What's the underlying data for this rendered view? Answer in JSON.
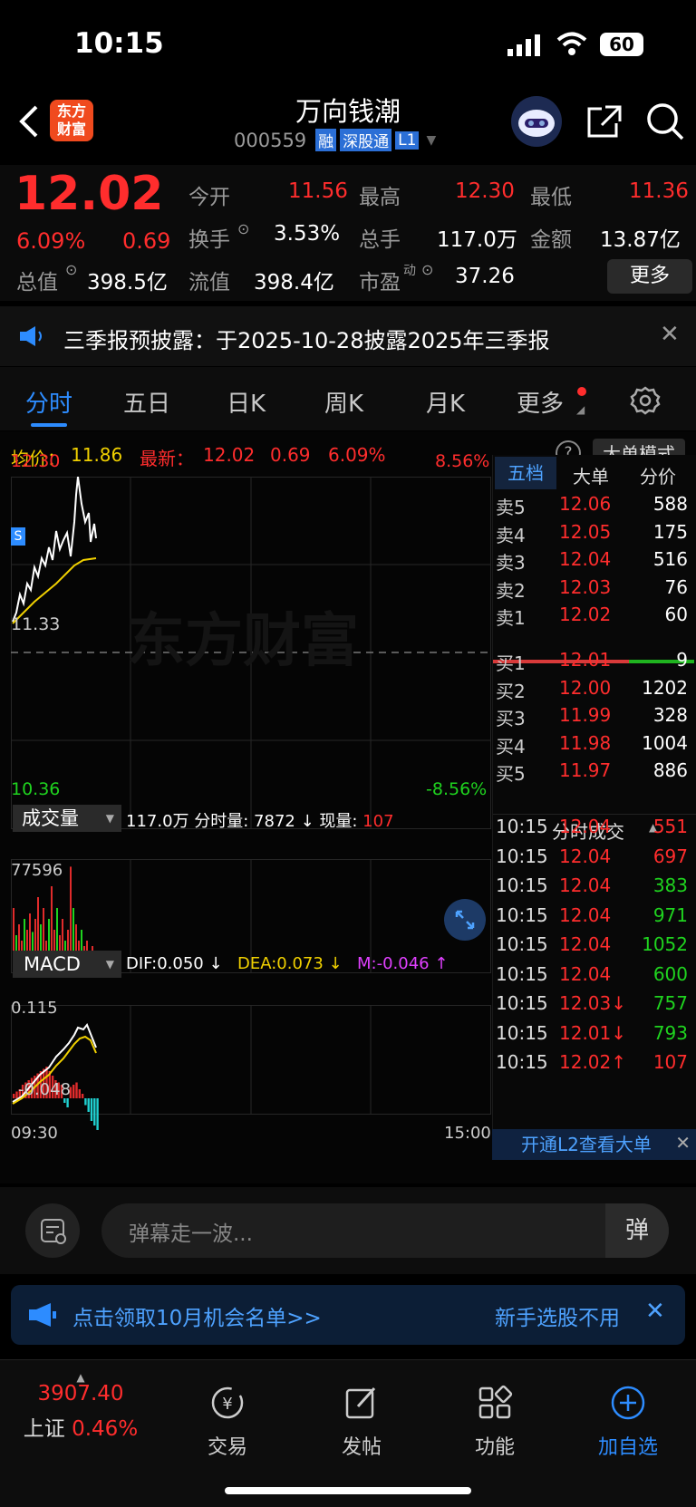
{
  "status": {
    "time": "10:15",
    "battery": "60"
  },
  "nav": {
    "logo_line1": "东方",
    "logo_line2": "财富",
    "title": "万向钱潮",
    "code": "000559",
    "tags": [
      "融",
      "深股通",
      "L1"
    ]
  },
  "quote": {
    "price": "12.02",
    "pct": "6.09%",
    "chg": "0.69",
    "stats": [
      {
        "label": "今开",
        "value": "11.56"
      },
      {
        "label": "最高",
        "value": "12.30"
      },
      {
        "label": "最低",
        "value": "11.36"
      },
      {
        "label": "换手",
        "value": "3.53%"
      },
      {
        "label": "总手",
        "value": "117.0万"
      },
      {
        "label": "金额",
        "value": "13.87亿"
      },
      {
        "label": "总值",
        "value": "398.5亿"
      },
      {
        "label": "流值",
        "value": "398.4亿"
      },
      {
        "label": "市盈",
        "sup": "动",
        "value": "37.26"
      }
    ],
    "more": "更多"
  },
  "notice": {
    "text": "三季报预披露：于2025-10-28披露2025年三季报"
  },
  "tabs": [
    "分时",
    "五日",
    "日K",
    "周K",
    "月K",
    "更多"
  ],
  "chart": {
    "avg_label": "均价：",
    "avg": "11.86",
    "latest_label": "最新：",
    "latest": "12.02",
    "chg": "0.69",
    "pct": "6.09%",
    "mode_btn": "大单模式",
    "y_top": "12.30",
    "y_mid": "11.33",
    "y_bot": "10.36",
    "pct_top": "8.56%",
    "pct_bot": "-8.56%",
    "watermark": "东方财富",
    "vol_label": "成交量",
    "vol_info": "117.0万 分时量: 7872 ↓ 现量: ",
    "vol_now": "107",
    "vol_max": "77596",
    "macd_label": "MACD",
    "dif": "DIF:0.050 ↓",
    "dea": "DEA:0.073 ↓",
    "m": "M:-0.046 ↑",
    "macd_top": "0.115",
    "macd_bot": "-0.048",
    "t_start": "09:30",
    "t_end": "15:00"
  },
  "orderbook": {
    "tabs": [
      "五档",
      "大单",
      "分价"
    ],
    "asks": [
      {
        "l": "卖5",
        "p": "12.06",
        "v": "588"
      },
      {
        "l": "卖4",
        "p": "12.05",
        "v": "175"
      },
      {
        "l": "卖3",
        "p": "12.04",
        "v": "516"
      },
      {
        "l": "卖2",
        "p": "12.03",
        "v": "76"
      },
      {
        "l": "卖1",
        "p": "12.02",
        "v": "60"
      }
    ],
    "bids": [
      {
        "l": "买1",
        "p": "12.01",
        "v": "9"
      },
      {
        "l": "买2",
        "p": "12.00",
        "v": "1202"
      },
      {
        "l": "买3",
        "p": "11.99",
        "v": "328"
      },
      {
        "l": "买4",
        "p": "11.98",
        "v": "1004"
      },
      {
        "l": "买5",
        "p": "11.97",
        "v": "886"
      }
    ],
    "ticks_title": "分时成交",
    "ticks": [
      {
        "t": "10:15",
        "p": "12.04",
        "v": "551",
        "c": "red"
      },
      {
        "t": "10:15",
        "p": "12.04",
        "v": "697",
        "c": "red"
      },
      {
        "t": "10:15",
        "p": "12.04",
        "v": "383",
        "c": "green"
      },
      {
        "t": "10:15",
        "p": "12.04",
        "v": "971",
        "c": "green"
      },
      {
        "t": "10:15",
        "p": "12.04",
        "v": "1052",
        "c": "green"
      },
      {
        "t": "10:15",
        "p": "12.04",
        "v": "600",
        "c": "green"
      },
      {
        "t": "10:15",
        "p": "12.03↓",
        "v": "757",
        "c": "green"
      },
      {
        "t": "10:15",
        "p": "12.01↓",
        "v": "793",
        "c": "green"
      },
      {
        "t": "10:15",
        "p": "12.02↑",
        "v": "107",
        "c": "red"
      }
    ],
    "l2": "开通L2查看大单"
  },
  "comment": {
    "placeholder": "弹幕走一波..."
  },
  "banner": {
    "left": "点击领取10月机会名单>>",
    "right": "新手选股不用"
  },
  "bottom": {
    "index_value": "3907.40",
    "index_name": "上证",
    "index_pct": "0.46%",
    "items": [
      "交易",
      "发帖",
      "功能",
      "加自选"
    ]
  }
}
